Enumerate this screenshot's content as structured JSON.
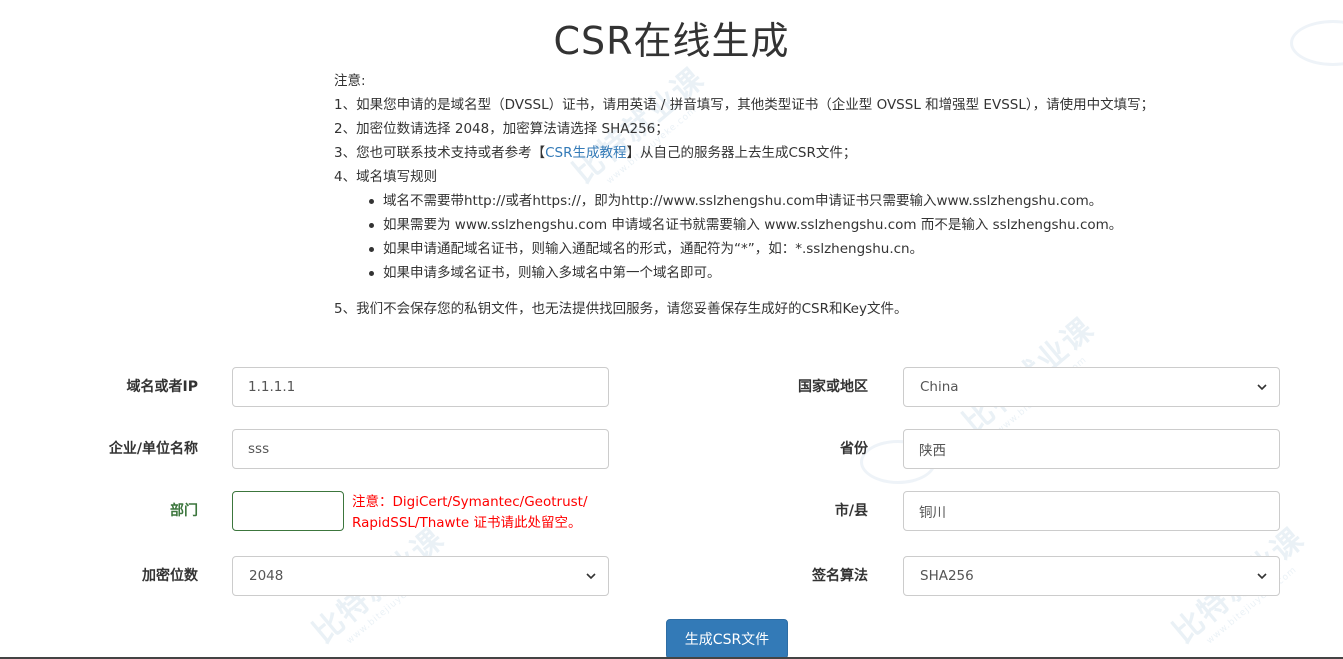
{
  "page": {
    "title": "CSR在线生成"
  },
  "notes": {
    "heading": "注意:",
    "item1": "1、如果您申请的是域名型（DVSSL）证书，请用英语 / 拼音填写，其他类型证书（企业型 OVSSL 和增强型 EVSSL），请使用中文填写；",
    "item2": "2、加密位数请选择 2048，加密算法请选择 SHA256；",
    "item3_pre": "3、您也可联系技术支持或者参考【",
    "item3_link": "CSR生成教程",
    "item3_post": "】从自己的服务器上去生成CSR文件；",
    "item4": "4、域名填写规则",
    "rules": [
      "域名不需要带http://或者https://，即为http://www.sslzhengshu.com申请证书只需要输入www.sslzhengshu.com。",
      "如果需要为 www.sslzhengshu.com 申请域名证书就需要输入 www.sslzhengshu.com 而不是输入 sslzhengshu.com。",
      "如果申请通配域名证书，则输入通配域名的形式，通配符为“*”，如：*.sslzhengshu.cn。",
      "如果申请多域名证书，则输入多域名中第一个域名即可。"
    ],
    "item5": "5、我们不会保存您的私钥文件，也无法提供找回服务，请您妥善保存生成好的CSR和Key文件。"
  },
  "form": {
    "domain": {
      "label": "域名或者IP",
      "value": "1.1.1.1"
    },
    "company": {
      "label": "企业/单位名称",
      "value": "sss"
    },
    "department": {
      "label": "部门",
      "value": "",
      "warning_line1": "注意：DigiCert/Symantec/Geotrust/",
      "warning_line2": "RapidSSL/Thawte 证书请此处留空。"
    },
    "bits": {
      "label": "加密位数",
      "value": "2048"
    },
    "country": {
      "label": "国家或地区",
      "value": "China"
    },
    "province": {
      "label": "省份",
      "value": "陕西"
    },
    "city": {
      "label": "市/县",
      "value": "铜川"
    },
    "algorithm": {
      "label": "签名算法",
      "value": "SHA256"
    },
    "submit_label": "生成CSR文件"
  },
  "watermark": {
    "text": "比特就业课",
    "url": "www.bitejiuyeke.com"
  },
  "colors": {
    "primary": "#337ab7",
    "warning": "#ff0000",
    "success": "#3c763d"
  },
  "icons": {
    "select": "chevron-down-icon"
  }
}
